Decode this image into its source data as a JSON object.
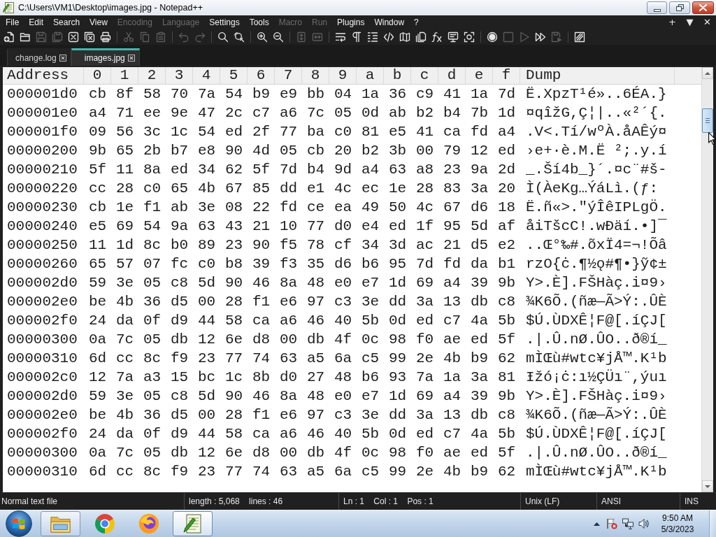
{
  "window": {
    "title": "C:\\Users\\VM1\\Desktop\\images.jpg - Notepad++"
  },
  "menu": {
    "items": [
      {
        "label": "File",
        "disabled": false
      },
      {
        "label": "Edit",
        "disabled": false
      },
      {
        "label": "Search",
        "disabled": false
      },
      {
        "label": "View",
        "disabled": false
      },
      {
        "label": "Encoding",
        "disabled": true
      },
      {
        "label": "Language",
        "disabled": true
      },
      {
        "label": "Settings",
        "disabled": false
      },
      {
        "label": "Tools",
        "disabled": false
      },
      {
        "label": "Macro",
        "disabled": true
      },
      {
        "label": "Run",
        "disabled": true
      },
      {
        "label": "Plugins",
        "disabled": false
      },
      {
        "label": "Window",
        "disabled": false
      },
      {
        "label": "?",
        "disabled": false
      }
    ],
    "controls": [
      "+",
      "▼",
      "✕"
    ]
  },
  "toolbar": {
    "groups": [
      [
        {
          "disabled": false
        },
        {
          "disabled": false
        },
        {
          "disabled": true
        },
        {
          "disabled": true
        },
        {
          "disabled": false
        },
        {
          "disabled": false
        },
        {
          "disabled": false
        }
      ],
      [
        {
          "disabled": true
        },
        {
          "disabled": true
        },
        {
          "disabled": true
        }
      ],
      [
        {
          "disabled": true
        },
        {
          "disabled": true
        }
      ],
      [
        {
          "disabled": false
        },
        {
          "disabled": false
        }
      ],
      [
        {
          "disabled": false
        },
        {
          "disabled": false
        }
      ],
      [
        {
          "disabled": true
        },
        {
          "disabled": true
        }
      ],
      [
        {
          "disabled": false
        },
        {
          "disabled": false
        },
        {
          "disabled": false
        },
        {
          "disabled": false
        },
        {
          "disabled": false
        },
        {
          "disabled": false
        },
        {
          "disabled": false
        },
        {
          "disabled": false
        },
        {
          "disabled": false
        }
      ],
      [
        {
          "disabled": false
        },
        {
          "disabled": true
        },
        {
          "disabled": true
        },
        {
          "disabled": false
        },
        {
          "disabled": true
        }
      ],
      [
        {
          "disabled": false
        }
      ]
    ]
  },
  "tabs": [
    {
      "label": "change.log",
      "selected": false
    },
    {
      "label": "images.jpg",
      "selected": true
    }
  ],
  "hex_view": {
    "columns": [
      "Address",
      "0",
      "1",
      "2",
      "3",
      "4",
      "5",
      "6",
      "7",
      "8",
      "9",
      "a",
      "b",
      "c",
      "d",
      "e",
      "f",
      "Dump"
    ],
    "rows": [
      {
        "address": "000001d0",
        "bytes": [
          "cb",
          "8f",
          "58",
          "70",
          "7a",
          "54",
          "b9",
          "e9",
          "bb",
          "04",
          "1a",
          "36",
          "c9",
          "41",
          "1a",
          "7d"
        ],
        "dump": "Ë.XpzT¹é»..6ÉA.}"
      },
      {
        "address": "000001e0",
        "bytes": [
          "a4",
          "71",
          "ee",
          "9e",
          "47",
          "2c",
          "c7",
          "a6",
          "7c",
          "05",
          "0d",
          "ab",
          "b2",
          "b4",
          "7b",
          "1d"
        ],
        "dump": "¤qîžG,Ç¦|..«²´{."
      },
      {
        "address": "000001f0",
        "bytes": [
          "09",
          "56",
          "3c",
          "1c",
          "54",
          "ed",
          "2f",
          "77",
          "ba",
          "c0",
          "81",
          "e5",
          "41",
          "ca",
          "fd",
          "a4"
        ],
        "dump": ".V<.Tí/wºÀ.åAÊý¤"
      },
      {
        "address": "00000200",
        "bytes": [
          "9b",
          "65",
          "2b",
          "b7",
          "e8",
          "90",
          "4d",
          "05",
          "cb",
          "20",
          "b2",
          "3b",
          "00",
          "79",
          "12",
          "ed"
        ],
        "dump": "›e+·è.M.Ë ²;.y.í"
      },
      {
        "address": "00000210",
        "bytes": [
          "5f",
          "11",
          "8a",
          "ed",
          "34",
          "62",
          "5f",
          "7d",
          "b4",
          "9d",
          "a4",
          "63",
          "a8",
          "23",
          "9a",
          "2d"
        ],
        "dump": "_.Ší4b_}´.¤c¨#š-"
      },
      {
        "address": "00000220",
        "bytes": [
          "cc",
          "28",
          "c0",
          "65",
          "4b",
          "67",
          "85",
          "dd",
          "e1",
          "4c",
          "ec",
          "1e",
          "28",
          "83",
          "3a",
          "20"
        ],
        "dump": "Ì(ÀeKg…ÝáLì.(ƒ:"
      },
      {
        "address": "00000230",
        "bytes": [
          "cb",
          "1e",
          "f1",
          "ab",
          "3e",
          "08",
          "22",
          "fd",
          "ce",
          "ea",
          "49",
          "50",
          "4c",
          "67",
          "d6",
          "18"
        ],
        "dump": "Ë.ñ«>.\"ýÎêIPLgÖ."
      },
      {
        "address": "00000240",
        "bytes": [
          "e5",
          "69",
          "54",
          "9a",
          "63",
          "43",
          "21",
          "10",
          "77",
          "d0",
          "e4",
          "ed",
          "1f",
          "95",
          "5d",
          "af"
        ],
        "dump": "åiTšcC!.wÐäí.•]¯"
      },
      {
        "address": "00000250",
        "bytes": [
          "11",
          "1d",
          "8c",
          "b0",
          "89",
          "23",
          "90",
          "f5",
          "78",
          "cf",
          "34",
          "3d",
          "ac",
          "21",
          "d5",
          "e2"
        ],
        "dump": "..Œ°‰#.õxÏ4=¬!Õâ"
      },
      {
        "address": "00000260",
        "bytes": [
          "65",
          "57",
          "07",
          "fc",
          "c0",
          "b8",
          "39",
          "f3",
          "35",
          "d6",
          "b6",
          "95",
          "7d",
          "fd",
          "da",
          "b1"
        ],
        "dump": "rzO{ċ.¶½ǫ#¶•}ỹ¢±"
      },
      {
        "address": "000002d0",
        "bytes": [
          "59",
          "3e",
          "05",
          "c8",
          "5d",
          "90",
          "46",
          "8a",
          "48",
          "e0",
          "e7",
          "1d",
          "69",
          "a4",
          "39",
          "9b"
        ],
        "dump": "Y>.È].FŠHàç.i¤9›"
      },
      {
        "address": "000002e0",
        "bytes": [
          "be",
          "4b",
          "36",
          "d5",
          "00",
          "28",
          "f1",
          "e6",
          "97",
          "c3",
          "3e",
          "dd",
          "3a",
          "13",
          "db",
          "c8"
        ],
        "dump": "¾K6Õ.(ñæ—Ã>Ý:.ÛÈ"
      },
      {
        "address": "000002f0",
        "bytes": [
          "24",
          "da",
          "0f",
          "d9",
          "44",
          "58",
          "ca",
          "a6",
          "46",
          "40",
          "5b",
          "0d",
          "ed",
          "c7",
          "4a",
          "5b"
        ],
        "dump": "$Ú.ÙDXÊ¦F@[.íÇJ["
      },
      {
        "address": "00000300",
        "bytes": [
          "0a",
          "7c",
          "05",
          "db",
          "12",
          "6e",
          "d8",
          "00",
          "db",
          "4f",
          "0c",
          "98",
          "f0",
          "ae",
          "ed",
          "5f"
        ],
        "dump": ".|.Û.nØ.ÛO..ð®í_"
      },
      {
        "address": "00000310",
        "bytes": [
          "6d",
          "cc",
          "8c",
          "f9",
          "23",
          "77",
          "74",
          "63",
          "a5",
          "6a",
          "c5",
          "99",
          "2e",
          "4b",
          "b9",
          "62"
        ],
        "dump": "mÌŒù#wtc¥jÅ™.K¹b"
      },
      {
        "address": "000002c0",
        "bytes": [
          "12",
          "7a",
          "a3",
          "15",
          "bc",
          "1c",
          "8b",
          "d0",
          "27",
          "48",
          "b6",
          "93",
          "7a",
          "1a",
          "3a",
          "81"
        ],
        "dump": "Ɨžó¡ċ:ı½ÇÜı¨,ýuı"
      },
      {
        "address": "000002d0",
        "bytes": [
          "59",
          "3e",
          "05",
          "c8",
          "5d",
          "90",
          "46",
          "8a",
          "48",
          "e0",
          "e7",
          "1d",
          "69",
          "a4",
          "39",
          "9b"
        ],
        "dump": "Y>.È].FŠHàç.i¤9›"
      },
      {
        "address": "000002e0",
        "bytes": [
          "be",
          "4b",
          "36",
          "d5",
          "00",
          "28",
          "f1",
          "e6",
          "97",
          "c3",
          "3e",
          "dd",
          "3a",
          "13",
          "db",
          "c8"
        ],
        "dump": "¾K6Õ.(ñæ—Ã>Ý:.ÛÈ"
      },
      {
        "address": "000002f0",
        "bytes": [
          "24",
          "da",
          "0f",
          "d9",
          "44",
          "58",
          "ca",
          "a6",
          "46",
          "40",
          "5b",
          "0d",
          "ed",
          "c7",
          "4a",
          "5b"
        ],
        "dump": "$Ú.ÙDXÊ¦F@[.íÇJ["
      },
      {
        "address": "00000300",
        "bytes": [
          "0a",
          "7c",
          "05",
          "db",
          "12",
          "6e",
          "d8",
          "00",
          "db",
          "4f",
          "0c",
          "98",
          "f0",
          "ae",
          "ed",
          "5f"
        ],
        "dump": ".|.Û.nØ.ÛO..ð®í_"
      },
      {
        "address": "00000310",
        "bytes": [
          "6d",
          "cc",
          "8c",
          "f9",
          "23",
          "77",
          "74",
          "63",
          "a5",
          "6a",
          "c5",
          "99",
          "2e",
          "4b",
          "b9",
          "62"
        ],
        "dump": "mÌŒù#wtc¥jÅ™.K¹b"
      }
    ]
  },
  "status_bar": {
    "file_type": "Normal text file",
    "length_lines": "length : 5,068    lines : 46",
    "position": "Ln : 1    Col : 1    Pos : 1",
    "eol": "Unix (LF)",
    "encoding": "ANSI",
    "mode": "INS"
  },
  "taskbar": {
    "apps": [
      {
        "running": true,
        "selected": false
      },
      {
        "running": false,
        "selected": false
      },
      {
        "running": false,
        "selected": false
      },
      {
        "running": true,
        "selected": true
      }
    ],
    "clock": {
      "time": "9:50 AM",
      "date": "5/3/2023"
    }
  }
}
